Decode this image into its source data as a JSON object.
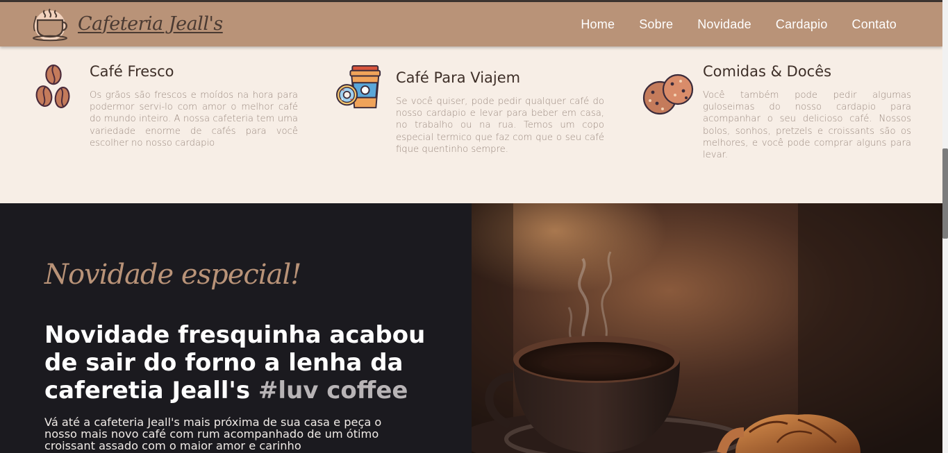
{
  "brand": {
    "name": "Cafeteria Jeall's",
    "logo_icon": "coffee-cup-icon"
  },
  "nav": {
    "links": [
      "Home",
      "Sobre",
      "Novidade",
      "Cardapio",
      "Contato"
    ]
  },
  "features": [
    {
      "icon": "coffee-beans-icon",
      "title": "Café Fresco",
      "text": "Os grãos são frescos e moídos na hora para podermor servi-lo com amor o melhor café do mundo inteiro. A nossa cafeteria tem uma variedade enorme de cafés para você escolher no nosso cardapio"
    },
    {
      "icon": "takeaway-cup-donut-icon",
      "title": "Café Para Viajem",
      "text": "Se você quiser, pode pedir qualquer café do nosso cardapio e levar para beber em casa, no trabalho ou na rua. Temos um copo especial termico que faz com que o seu café fique quentinho sempre."
    },
    {
      "icon": "cookies-icon",
      "title": "Comidas & Docês",
      "text": "Você também pode pedir algumas guloseimas do nosso cardapio para acompanhar o seu delicioso café. Nossos bolos, sonhos, pretzels e croissants são os melhores, e você pode comprar alguns para levar."
    }
  ],
  "special": {
    "script_title": "Novidade especial!",
    "title_main": "Novidade fresquinha acabou de sair do forno a lenha da caferetia Jeall's",
    "title_highlight": "#luv coffee",
    "text": "Vá até a cafeteria Jeall's mais próxima de sua casa e peça o nosso mais novo café com rum acompanhado de um ótimo croissant assado com o maior amor e carinho"
  },
  "colors": {
    "navbar": "#b99378",
    "cream": "#f7eee6",
    "dark": "#1b1a1f",
    "accent": "#b99378"
  }
}
